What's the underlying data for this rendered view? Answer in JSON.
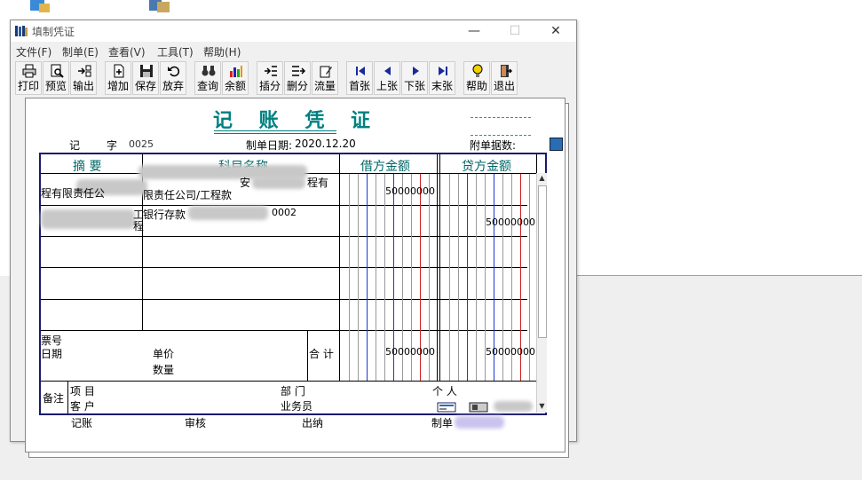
{
  "window": {
    "title": "填制凭证",
    "min_glyph": "—",
    "max_glyph": "☐",
    "close_glyph": "✕"
  },
  "menu": [
    {
      "label": "文件(F)",
      "name": "menu-file"
    },
    {
      "label": "制单(E)",
      "name": "menu-voucher"
    },
    {
      "label": "查看(V)",
      "name": "menu-view"
    },
    {
      "label": "工具(T)",
      "name": "menu-tools"
    },
    {
      "label": "帮助(H)",
      "name": "menu-help"
    }
  ],
  "toolbar": [
    {
      "label": "打印",
      "name": "print-button",
      "icon": "printer-icon"
    },
    {
      "label": "预览",
      "name": "preview-button",
      "icon": "preview-icon"
    },
    {
      "label": "输出",
      "name": "export-button",
      "icon": "export-icon"
    },
    {
      "label": "增加",
      "name": "add-button",
      "icon": "add-icon"
    },
    {
      "label": "保存",
      "name": "save-button",
      "icon": "save-icon"
    },
    {
      "label": "放弃",
      "name": "discard-button",
      "icon": "undo-icon"
    },
    {
      "label": "查询",
      "name": "query-button",
      "icon": "binoculars-icon"
    },
    {
      "label": "余额",
      "name": "balance-button",
      "icon": "bar-chart-icon"
    },
    {
      "label": "插分",
      "name": "insert-entry-button",
      "icon": "insert-row-icon"
    },
    {
      "label": "删分",
      "name": "delete-entry-button",
      "icon": "delete-row-icon"
    },
    {
      "label": "流量",
      "name": "cashflow-button",
      "icon": "pen-icon"
    },
    {
      "label": "首张",
      "name": "first-button",
      "icon": "first-icon"
    },
    {
      "label": "上张",
      "name": "prev-button",
      "icon": "prev-icon"
    },
    {
      "label": "下张",
      "name": "next-button",
      "icon": "next-icon"
    },
    {
      "label": "末张",
      "name": "last-button",
      "icon": "last-icon"
    },
    {
      "label": "帮助",
      "name": "help-button",
      "icon": "lightbulb-icon"
    },
    {
      "label": "退出",
      "name": "exit-button",
      "icon": "exit-door-icon"
    }
  ],
  "voucher": {
    "title": "记 账 凭 证",
    "type_label_1": "记",
    "type_label_2": "字",
    "number": "0025",
    "date_label": "制单日期:",
    "date": "2020.12.20",
    "attach_label": "附单据数:",
    "col_summary": "摘  要",
    "col_subject": "科目名称",
    "col_debit": "借方金额",
    "col_credit": "贷方金额",
    "rows": [
      {
        "summary_line2": "程有限责任公",
        "subject_line1": "安",
        "subject_line1b": "程有",
        "subject_line2": "限责任公司/工程款",
        "debit": "50000000",
        "credit": ""
      },
      {
        "summary_tail1": "工",
        "summary_tail2": "程",
        "subject_line1": "银行存款",
        "subject_tail": "0002",
        "debit": "",
        "credit": "50000000"
      }
    ],
    "ticket_label": "票号",
    "date_row_label": "日期",
    "unit_price_label": "单价",
    "quantity_label": "数量",
    "total_label": "合  计",
    "total_debit": "50000000",
    "total_credit": "50000000",
    "remark_label": "备注",
    "project_label": "项    目",
    "customer_label": "客    户",
    "dept_label": "部    门",
    "salesperson_label": "业务员",
    "person_label": "个    人",
    "footer": {
      "bookkeeping": "记账",
      "review": "审核",
      "cashier": "出纳",
      "maker": "制单"
    }
  }
}
